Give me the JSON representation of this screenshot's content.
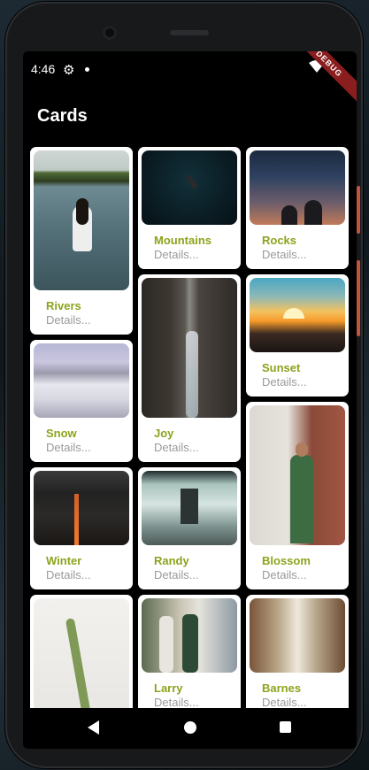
{
  "status": {
    "time": "4:46",
    "debug_label": "DEBUG"
  },
  "appbar": {
    "title": "Cards"
  },
  "cards": [
    {
      "title": "Rivers",
      "subtitle": "Details..."
    },
    {
      "title": "Mountains",
      "subtitle": "Details..."
    },
    {
      "title": "Rocks",
      "subtitle": "Details..."
    },
    {
      "title": "Joy",
      "subtitle": "Details..."
    },
    {
      "title": "Sunset",
      "subtitle": "Details..."
    },
    {
      "title": "Snow",
      "subtitle": "Details..."
    },
    {
      "title": "Blossom",
      "subtitle": "Details..."
    },
    {
      "title": "Winter",
      "subtitle": "Details..."
    },
    {
      "title": "Randy",
      "subtitle": "Details..."
    },
    {
      "title": "Larry",
      "subtitle": "Details..."
    },
    {
      "title": "Barnes",
      "subtitle": "Details..."
    }
  ],
  "colors": {
    "title_accent": "#8aa41c",
    "subtitle": "#9a9a9a",
    "card_bg": "#ffffff",
    "screen_bg": "#000000"
  },
  "icons": {
    "settings": "gear-icon",
    "wifi": "wifi-icon",
    "battery": "battery-icon",
    "back": "back-icon",
    "home": "home-icon",
    "recents": "recents-icon"
  }
}
